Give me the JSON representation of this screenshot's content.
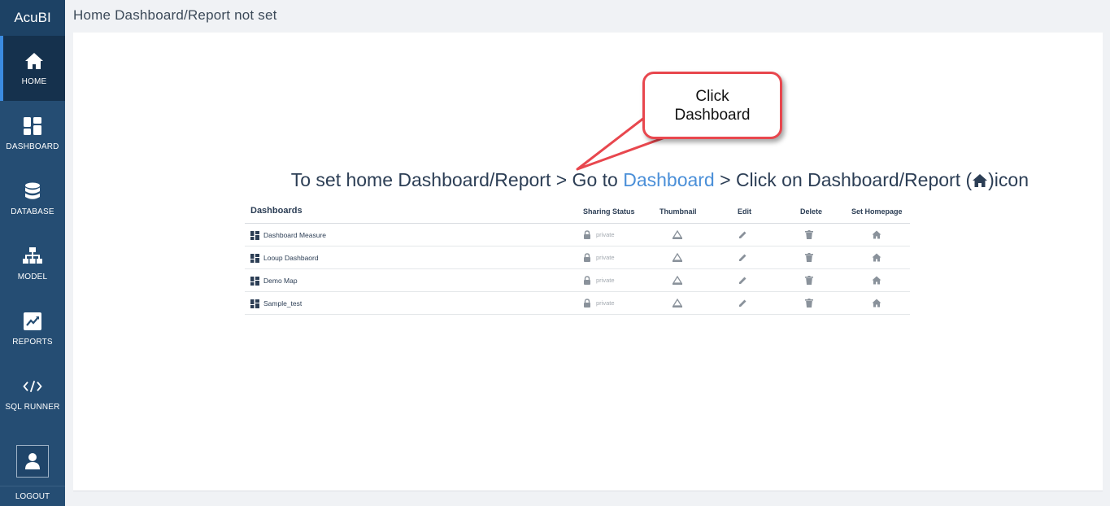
{
  "app": {
    "brand": "AcuBI"
  },
  "sidebar": {
    "items": [
      {
        "label": "HOME",
        "icon": "home-icon",
        "active": true
      },
      {
        "label": "DASHBOARD",
        "icon": "dashboard-icon",
        "active": false
      },
      {
        "label": "DATABASE",
        "icon": "database-icon",
        "active": false
      },
      {
        "label": "MODEL",
        "icon": "sitemap-icon",
        "active": false
      },
      {
        "label": "REPORTS",
        "icon": "chart-icon",
        "active": false
      },
      {
        "label": "SQL RUNNER",
        "icon": "code-icon",
        "active": false
      }
    ],
    "logout_label": "LOGOUT"
  },
  "header": {
    "title": "Home Dashboard/Report not set"
  },
  "main": {
    "instruction": {
      "prefix": "To set home Dashboard/Report > Go to ",
      "link": "Dashboard",
      "middle": " > Click on Dashboard/Report (",
      "suffix": ")icon"
    },
    "callout": {
      "line1": "Click",
      "line2": "Dashboard"
    },
    "table": {
      "headers": {
        "name": "Dashboards",
        "sharing": "Sharing Status",
        "thumbnail": "Thumbnail",
        "edit": "Edit",
        "delete": "Delete",
        "homepage": "Set Homepage"
      },
      "rows": [
        {
          "name": "Dashboard Measure",
          "status": "private"
        },
        {
          "name": "Looup Dashbaord",
          "status": "private"
        },
        {
          "name": "Demo Map",
          "status": "private"
        },
        {
          "name": "Sample_test",
          "status": "private"
        }
      ]
    }
  },
  "colors": {
    "sidebar": "#254d73",
    "sidebar_active": "#15314d",
    "accent": "#3b8be0",
    "link": "#4a8fd8",
    "callout_border": "#e8474e"
  }
}
